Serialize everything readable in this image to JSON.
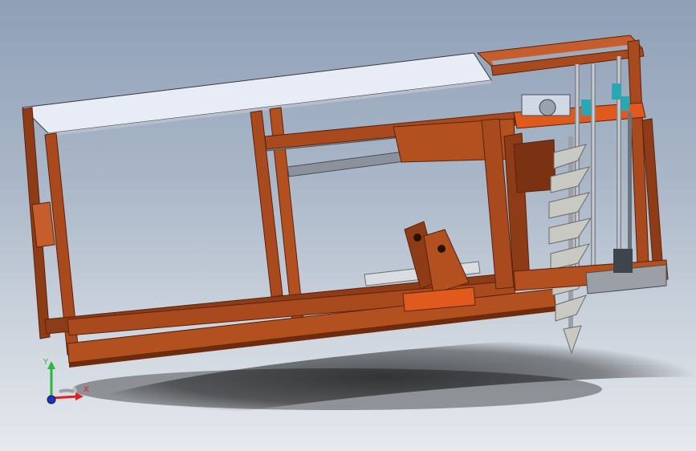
{
  "viewport": {
    "background_top": "#8fa0b7",
    "background_bottom": "#e6e9ee"
  },
  "colors": {
    "frame": "#a94a1e",
    "frame_light": "#c55e2c",
    "frame_dark": "#6e2c0f",
    "panel": "#e7ecf6",
    "steel": "#8b929c",
    "auger": "#c9c9c4"
  },
  "triad": {
    "x_label": "X",
    "y_label": "Y",
    "x_color": "#e02020",
    "y_color": "#2bb53a",
    "z_color": "#2030c0"
  }
}
